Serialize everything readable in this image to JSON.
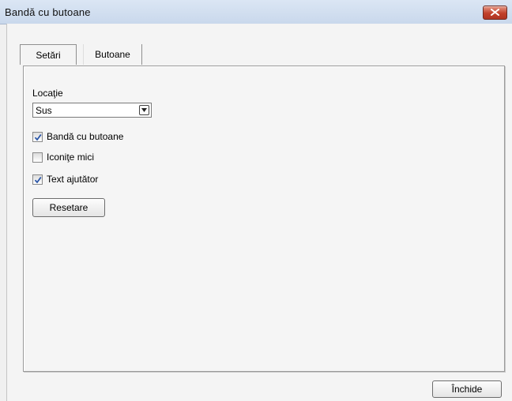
{
  "window": {
    "title": "Bandă cu butoane"
  },
  "tabs": [
    {
      "label": "Setări",
      "active": true
    },
    {
      "label": "Butoane",
      "active": false
    }
  ],
  "settings": {
    "location_label": "Locaţie",
    "location_value": "Sus",
    "checkboxes": [
      {
        "label": "Bandă cu butoane",
        "checked": true
      },
      {
        "label": "Iconiţe mici",
        "checked": false
      },
      {
        "label": "Text ajutător",
        "checked": true
      }
    ],
    "reset_label": "Resetare"
  },
  "footer": {
    "close_label": "Închide"
  },
  "icons": {
    "close": "close-icon",
    "dropdown": "chevron-down-icon",
    "check": "check-icon"
  },
  "colors": {
    "titlebar": "#c9d8ec",
    "close_button": "#c1402a",
    "check": "#2a56a8"
  }
}
